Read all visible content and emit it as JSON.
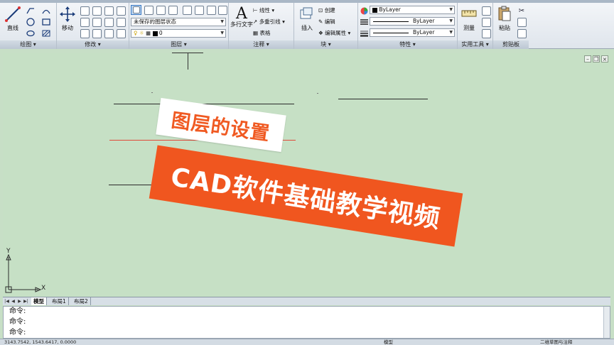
{
  "ribbon": {
    "draw": {
      "title": "绘图",
      "line_label": "直线"
    },
    "modify": {
      "title": "修改",
      "move_label": "移动"
    },
    "layers": {
      "title": "图层",
      "state_combo": "未保存的图层状态",
      "layer_combo": "0"
    },
    "annotation": {
      "title": "注释",
      "mtext_label": "多行文字",
      "linear_label": "线性",
      "mleader_label": "多重引线",
      "table_label": "表格"
    },
    "block": {
      "title": "块",
      "insert_label": "插入",
      "create_label": "创建",
      "edit_label": "编辑",
      "edit_attr_label": "编辑属性"
    },
    "properties": {
      "title": "特性",
      "color_value": "ByLayer",
      "linetype_value": "ByLayer",
      "lineweight_value": "ByLayer"
    },
    "utilities": {
      "title": "实用工具",
      "measure_label": "测量"
    },
    "clipboard": {
      "title": "剪贴板",
      "paste_label": "粘贴"
    }
  },
  "canvas": {
    "overlay_title": "图层的设置",
    "overlay_banner": "CAD软件基础教学视频",
    "ucs_x": "X",
    "ucs_y": "Y",
    "colors": {
      "background": "#c6e0c5",
      "accent": "#f0561f",
      "red_line": "#e04a3a"
    }
  },
  "tabs": [
    {
      "label": "模型",
      "active": true
    },
    {
      "label": "布局1",
      "active": false
    },
    {
      "label": "布局2",
      "active": false
    }
  ],
  "command": {
    "lines": [
      "命令:",
      "命令:",
      "命令:"
    ]
  },
  "status": {
    "coords": "3143.7542, 1543.6417, 0.0000",
    "model_label": "模型",
    "annotate_label": "二维草图与注释"
  }
}
